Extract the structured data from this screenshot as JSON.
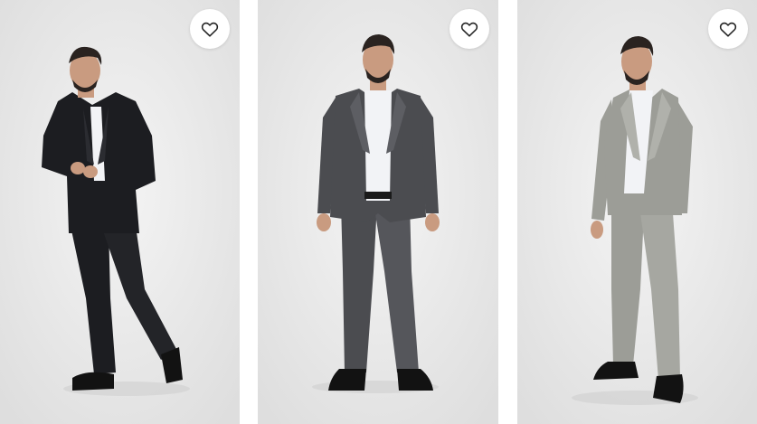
{
  "products": [
    {
      "suit_color": "#1c1d21",
      "suit_shade": "#2b2c31",
      "favorite_icon": "heart-outline-icon"
    },
    {
      "suit_color": "#4b4c50",
      "suit_shade": "#5d5e63",
      "favorite_icon": "heart-outline-icon"
    },
    {
      "suit_color": "#9c9d97",
      "suit_shade": "#b0b1ab",
      "favorite_icon": "heart-outline-icon"
    }
  ],
  "colors": {
    "background": "#e9e9e9",
    "favorite_button": "#ffffff",
    "icon_stroke": "#222222",
    "shirt": "#f2f3f6",
    "skin": "#c99b80",
    "hair": "#2a2320",
    "shoe": "#121212"
  }
}
